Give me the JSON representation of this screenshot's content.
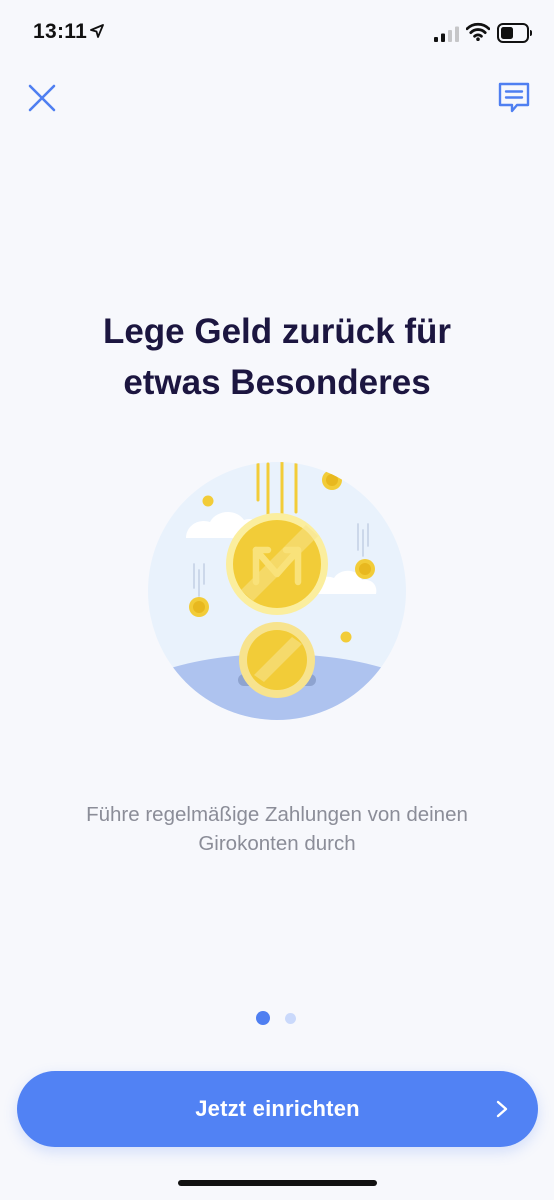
{
  "status_bar": {
    "time": "13:11",
    "icons": [
      "location-arrow-icon",
      "signal-icon",
      "wifi-icon",
      "battery-icon"
    ]
  },
  "header": {
    "close_icon": "close-icon",
    "chat_icon": "chat-icon"
  },
  "onboarding": {
    "title_line_1": "Lege Geld zurück für",
    "title_line_2": "etwas Besonderes",
    "illustration": "falling-coins-illustration",
    "subtitle_line_1": "Führe regelmäßige Zahlungen von deinen",
    "subtitle_line_2": "Girokonten durch",
    "page_count": 2,
    "current_page": 1
  },
  "cta": {
    "label": "Jetzt einrichten",
    "icon": "chevron-right-icon"
  },
  "colors": {
    "accent": "#5182f4",
    "title": "#1c1640",
    "subtitle": "#8b8d98",
    "background": "#f7f8fc",
    "coin": "#f2cc38",
    "dot_inactive": "#cad9fb"
  }
}
